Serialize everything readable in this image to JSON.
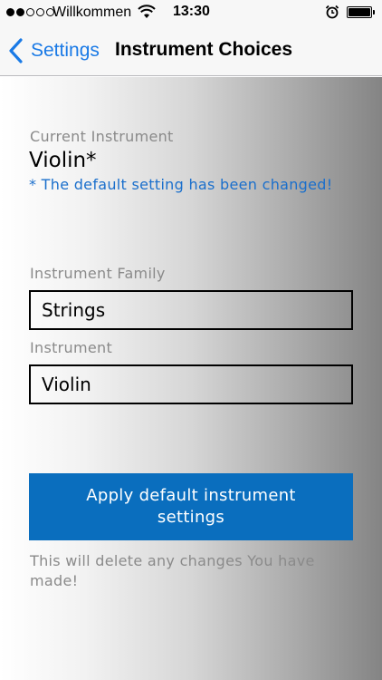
{
  "status_bar": {
    "carrier": "Willkommen",
    "time": "13:30",
    "signal_bars_filled": 2,
    "signal_bars_total": 5,
    "battery_level": 1.0,
    "icons": [
      "wifi-icon",
      "alarm-icon",
      "battery-icon"
    ]
  },
  "nav": {
    "back_label": "Settings",
    "title": "Instrument Choices"
  },
  "current": {
    "label": "Current Instrument",
    "value": "Violin*",
    "note": "* The default setting has been changed!"
  },
  "family": {
    "label": "Instrument Family",
    "value": "Strings"
  },
  "instrument": {
    "label": "Instrument",
    "value": "Violin"
  },
  "apply_button": {
    "label": "Apply default instrument settings"
  },
  "warning": "This will delete any changes You have made!",
  "colors": {
    "accent": "#1a7ae6",
    "note": "#1a6fcc",
    "button": "#0a6ebe"
  }
}
